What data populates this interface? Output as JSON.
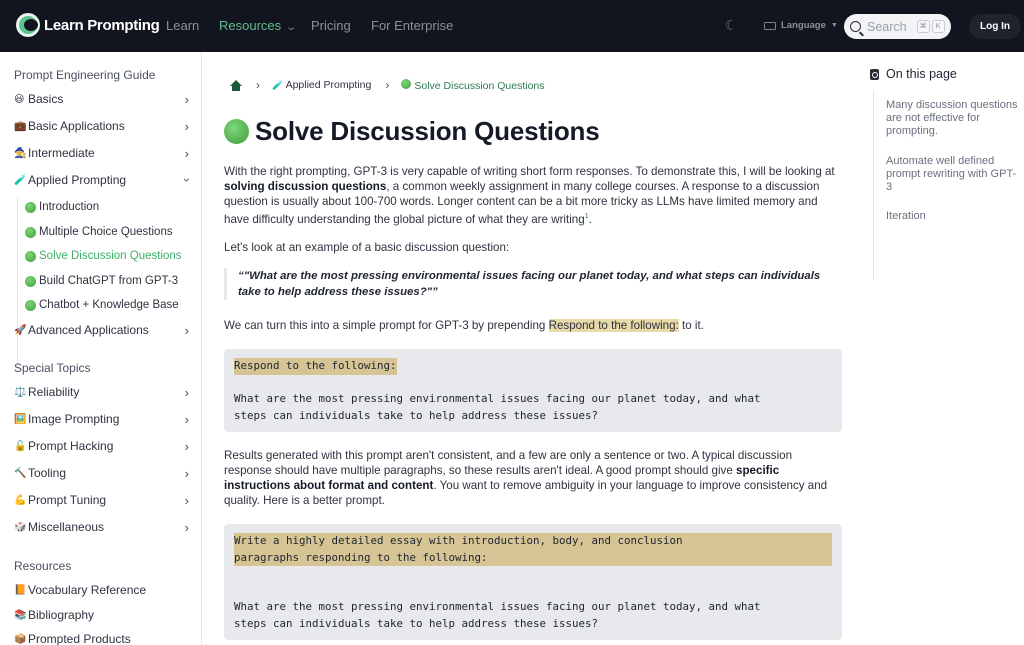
{
  "nav": {
    "brand": "Learn Prompting",
    "links": [
      {
        "label": "Learn",
        "active": false
      },
      {
        "label": "Resources",
        "active": true,
        "has_dropdown": true
      },
      {
        "label": "Pricing",
        "active": false
      },
      {
        "label": "For Enterprise",
        "active": false
      }
    ],
    "theme_toggle_icon": "theme-toggle-icon",
    "language_label": "Language",
    "search_placeholder": "Search",
    "search_shortcut": [
      "⌘",
      "K"
    ],
    "login_label": "Log In"
  },
  "sidebar": {
    "sections": [
      {
        "title": "Prompt Engineering Guide",
        "items": [
          {
            "emoji": "😃",
            "label": "Basics",
            "expandable": true
          },
          {
            "emoji": "💼",
            "label": "Basic Applications",
            "expandable": true
          },
          {
            "emoji": "🧙",
            "label": "Intermediate",
            "expandable": true
          },
          {
            "emoji": "🧪",
            "label": "Applied Prompting",
            "expandable": true,
            "expanded": true,
            "children": [
              {
                "label": "Introduction",
                "active": false
              },
              {
                "label": "Multiple Choice Questions",
                "active": false
              },
              {
                "label": "Solve Discussion Questions",
                "active": true
              },
              {
                "label": "Build ChatGPT from GPT-3",
                "active": false
              },
              {
                "label": "Chatbot + Knowledge Base",
                "active": false
              }
            ]
          },
          {
            "emoji": "🚀",
            "label": "Advanced Applications",
            "expandable": true
          }
        ]
      },
      {
        "title": "Special Topics",
        "items": [
          {
            "emoji": "⚖️",
            "label": "Reliability",
            "expandable": true
          },
          {
            "emoji": "🖼️",
            "label": "Image Prompting",
            "expandable": true
          },
          {
            "emoji": "🔓",
            "label": "Prompt Hacking",
            "expandable": true
          },
          {
            "emoji": "🔨",
            "label": "Tooling",
            "expandable": true
          },
          {
            "emoji": "💪",
            "label": "Prompt Tuning",
            "expandable": true
          },
          {
            "emoji": "🎲",
            "label": "Miscellaneous",
            "expandable": true
          }
        ]
      },
      {
        "title": "Resources",
        "items": [
          {
            "emoji": "📙",
            "label": "Vocabulary Reference"
          },
          {
            "emoji": "📚",
            "label": "Bibliography"
          },
          {
            "emoji": "📦",
            "label": "Prompted Products"
          }
        ]
      }
    ]
  },
  "breadcrumb": {
    "parent": "Applied Prompting",
    "parent_emoji": "🧪",
    "current": "Solve Discussion Questions"
  },
  "article": {
    "title": "Solve Discussion Questions",
    "intro": {
      "p1_a": "With the right prompting, GPT-3 is very capable of writing short form responses. To demonstrate this, I will be looking at ",
      "p1_bold": "solving discussion questions",
      "p1_b": ", a common weekly assignment in many college courses. A response to a discussion question is usually about 100-700 words. Longer content can be a bit more tricky as LLMs have limited memory and have difficulty understanding the global picture of what they are writing",
      "p1_footnote": "1",
      "p1_end": "."
    },
    "p2": "Let's look at an example of a basic discussion question:",
    "quote": "“\"What are the most pressing environmental issues facing our planet today, and what steps can individuals take to help address these issues?\"”",
    "p3_a": "We can turn this into a simple prompt for GPT-3 by prepending ",
    "p3_highlight": "Respond to the following:",
    "p3_b": " to it.",
    "code1": {
      "highlight": "Respond to the following:",
      "body": "What are the most pressing environmental issues facing our planet today, and what\nsteps can individuals take to help address these issues?"
    },
    "p4_a": "Results generated with this prompt aren't consistent, and a few are only a sentence or two. A typical discussion response should have multiple paragraphs, so these results aren't ideal. A good prompt should give ",
    "p4_bold": "specific instructions about format and content",
    "p4_b": ". You want to remove ambiguity in your language to improve consistency and quality. Here is a better prompt.",
    "code2": {
      "highlight": "Write a highly detailed essay with introduction, body, and conclusion\nparagraphs responding to the following:",
      "body": "What are the most pressing environmental issues facing our planet today, and what\nsteps can individuals take to help address these issues?"
    }
  },
  "toc": {
    "title": "On this page",
    "items": [
      "Many discussion questions are not effective for prompting.",
      "Automate well defined prompt rewriting with GPT-3",
      "Iteration"
    ]
  },
  "colors": {
    "nav_bg": "#12151f",
    "accent_green": "#3fae6a",
    "highlight": "#e8d9a8",
    "code_bg": "#e8e9ed"
  }
}
